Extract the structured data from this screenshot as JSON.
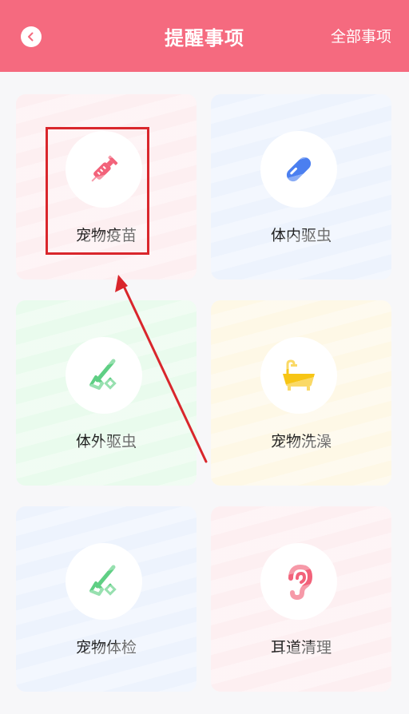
{
  "header": {
    "title": "提醒事项",
    "all_items_label": "全部事项"
  },
  "colors": {
    "header_bg": "#f56a7f",
    "annotation": "#d9262c"
  },
  "cards": [
    {
      "label": "宠物疫苗",
      "icon": "syringe-icon",
      "bg": "#fdeff1",
      "icon_color": "#f2627a"
    },
    {
      "label": "体内驱虫",
      "icon": "pill-capsule-icon",
      "bg": "#edf3fd",
      "icon_color": "#4b7ff0"
    },
    {
      "label": "体外驱虫",
      "icon": "flea-comb-icon",
      "bg": "#e9fbed",
      "icon_color": "#5fcf84"
    },
    {
      "label": "宠物洗澡",
      "icon": "bathtub-icon",
      "bg": "#fef8e6",
      "icon_color": "#f7c514"
    },
    {
      "label": "宠物体检",
      "icon": "flea-comb-icon",
      "bg": "#edf3fd",
      "icon_color": "#5fcf84"
    },
    {
      "label": "耳道清理",
      "icon": "ear-icon",
      "bg": "#fdeff1",
      "icon_color": "#f2627a"
    }
  ]
}
